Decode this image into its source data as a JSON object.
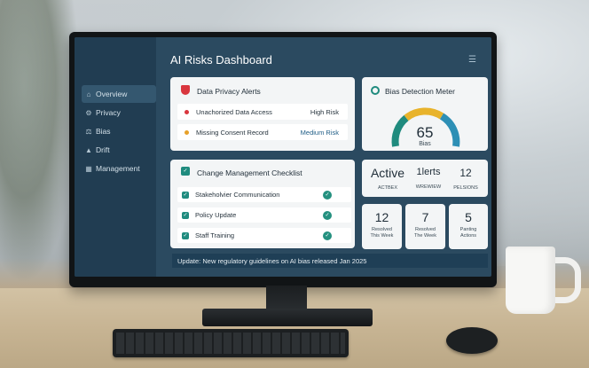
{
  "app": {
    "title": "AI Risks Dashboard"
  },
  "sidebar": {
    "items": [
      {
        "label": "Overview",
        "icon": "home-icon",
        "active": true
      },
      {
        "label": "Privacy",
        "icon": "gear-icon"
      },
      {
        "label": "Bias",
        "icon": "scale-icon"
      },
      {
        "label": "Drift",
        "icon": "drift-icon"
      },
      {
        "label": "Management",
        "icon": "grid-icon"
      }
    ]
  },
  "privacy_alerts": {
    "title": "Data Privacy Alerts",
    "icon": "shield-icon",
    "items": [
      {
        "label": "Unachorized Data Access",
        "risk": "High Risk",
        "color": "#d9363e"
      },
      {
        "label": "Missing Consent Record",
        "risk": "Medium Risk",
        "color": "#e7a12a"
      }
    ]
  },
  "bias_meter": {
    "title": "Bias Detection Meter",
    "value": "65",
    "unit": "Bias",
    "level": 0.65,
    "colors": {
      "low": "#1f8b7e",
      "mid": "#e8b32b",
      "high": "#2d8fb5"
    }
  },
  "checklist": {
    "title": "Change Management Checklist",
    "items": [
      {
        "label": "Stakeholvier Communication"
      },
      {
        "label": "Policy Update"
      },
      {
        "label": "Staff Training"
      }
    ]
  },
  "stats_top": [
    {
      "value": "Active",
      "label": "ACTBEX"
    },
    {
      "value": "1lerts",
      "label": "WREWIEW"
    },
    {
      "value": "12",
      "label": "PELSIONS"
    }
  ],
  "stats_bottom": [
    {
      "value": "12",
      "label1": "Resolved",
      "label2": "This Week"
    },
    {
      "value": "7",
      "label1": "Resolved",
      "label2": "The Week"
    },
    {
      "value": "5",
      "label1": "Panting",
      "label2": "Actions"
    }
  ],
  "banner": {
    "text": "Update: New regulatory guidelines on AI bias released Jan 2025"
  }
}
